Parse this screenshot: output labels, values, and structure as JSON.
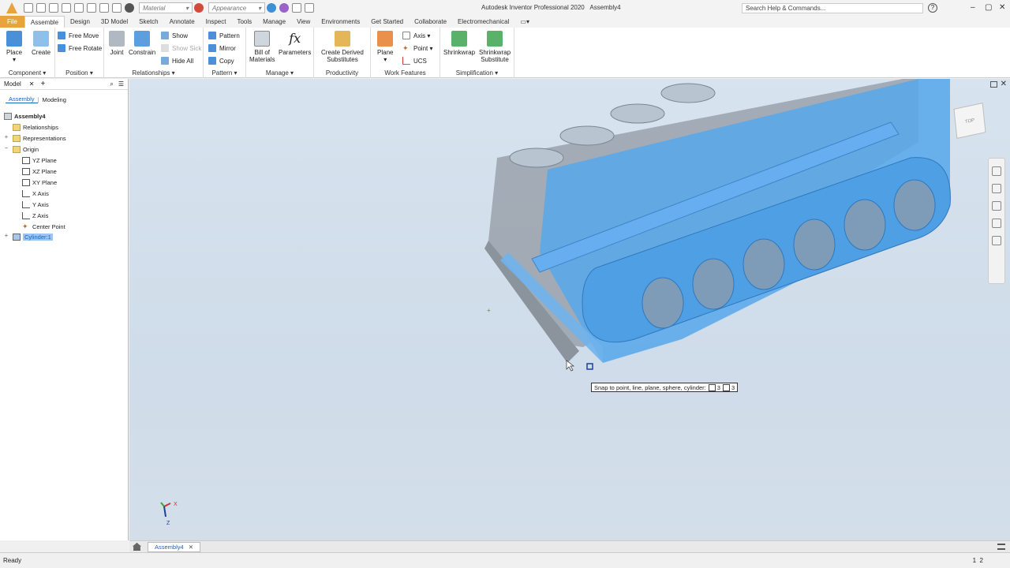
{
  "window": {
    "title": "Autodesk Inventor Professional 2020",
    "document_name": "Assembly4",
    "search_placeholder": "Search Help & Commands..."
  },
  "quick_access": {
    "material_value": "Material",
    "appearance_value": "Appearance"
  },
  "ribbon_tabs": [
    "File",
    "Assemble",
    "Design",
    "3D Model",
    "Sketch",
    "Annotate",
    "Inspect",
    "Tools",
    "Manage",
    "View",
    "Environments",
    "Get Started",
    "Collaborate",
    "Electromechanical"
  ],
  "active_tab": "Assemble",
  "ribbon": {
    "component": {
      "label": "Component",
      "place": "Place",
      "create": "Create"
    },
    "position": {
      "label": "Position",
      "free_move": "Free Move",
      "free_rotate": "Free Rotate"
    },
    "relationships": {
      "label": "Relationships",
      "joint": "Joint",
      "constrain": "Constrain",
      "show": "Show",
      "show_sick": "Show Sick",
      "hide_all": "Hide All"
    },
    "pattern": {
      "label": "Pattern",
      "pattern": "Pattern",
      "mirror": "Mirror",
      "copy": "Copy"
    },
    "manage": {
      "label": "Manage",
      "bom_line1": "Bill of",
      "bom_line2": "Materials",
      "parameters": "Parameters",
      "fx": "fx"
    },
    "productivity": {
      "label": "Productivity",
      "cds_line1": "Create Derived",
      "cds_line2": "Substitutes"
    },
    "work_features": {
      "label": "Work Features",
      "plane": "Plane",
      "axis": "Axis",
      "point": "Point",
      "ucs": "UCS"
    },
    "simplification": {
      "label": "Simplification",
      "shrinkwrap": "Shrinkwrap",
      "sws_line1": "Shrinkwrap",
      "sws_line2": "Substitute"
    }
  },
  "browser": {
    "title": "Model",
    "tabs": [
      "Assembly",
      "Modeling"
    ],
    "tree": {
      "root": "Assembly4",
      "relationships": "Relationships",
      "representations": "Representations",
      "origin": "Origin",
      "yz_plane": "YZ Plane",
      "xz_plane": "XZ Plane",
      "xy_plane": "XY Plane",
      "x_axis": "X Axis",
      "y_axis": "Y Axis",
      "z_axis": "Z Axis",
      "center_point": "Center Point",
      "cylinder": "Cylinder:1"
    }
  },
  "viewport": {
    "snap_tooltip": "Snap to point, line, plane, sphere, cylinder:",
    "snap_count_1": "3",
    "snap_count_2": "3",
    "view_cube_face": "TOP",
    "triad_x": "X",
    "triad_z": "Z"
  },
  "document_tab": "Assembly4",
  "status": {
    "text": "Ready",
    "num1": "1",
    "num2": "2"
  },
  "colors": {
    "file_tab": "#e8a33c",
    "viewport_bg": "#d3dfeb",
    "model_blue": "#59a8ea",
    "model_gray": "#9aa2ab",
    "selection_blue": "#1565c0"
  }
}
